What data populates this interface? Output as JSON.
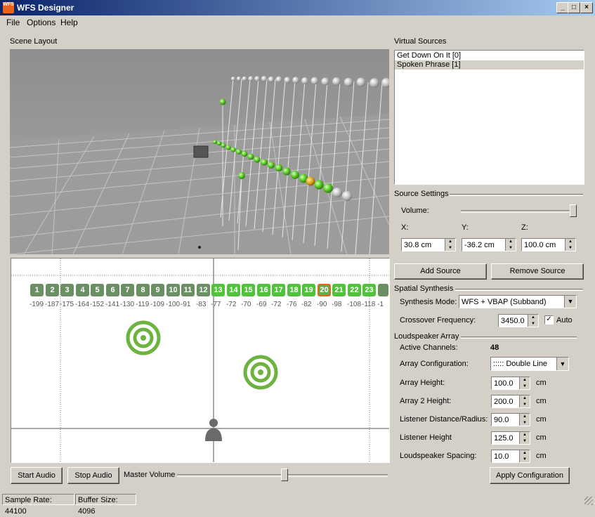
{
  "window": {
    "title": "WFS Designer",
    "icon_text": "WFS",
    "buttons": {
      "minimize": "_",
      "maximize": "□",
      "close": "×"
    }
  },
  "menu": [
    "File",
    "Options",
    "Help"
  ],
  "scene": {
    "label": "Scene Layout"
  },
  "channels": [
    {
      "num": "1",
      "dist": "-199",
      "state": "gray"
    },
    {
      "num": "2",
      "dist": "-187",
      "state": "gray"
    },
    {
      "num": "3",
      "dist": "-175",
      "state": "gray"
    },
    {
      "num": "4",
      "dist": "-164",
      "state": "gray"
    },
    {
      "num": "5",
      "dist": "-152",
      "state": "gray"
    },
    {
      "num": "6",
      "dist": "-141",
      "state": "gray"
    },
    {
      "num": "7",
      "dist": "-130",
      "state": "gray"
    },
    {
      "num": "8",
      "dist": "-119",
      "state": "gray"
    },
    {
      "num": "9",
      "dist": "-109",
      "state": "gray"
    },
    {
      "num": "10",
      "dist": "-100",
      "state": "gray"
    },
    {
      "num": "11",
      "dist": "-91",
      "state": "gray"
    },
    {
      "num": "12",
      "dist": "-83",
      "state": "gray"
    },
    {
      "num": "13",
      "dist": "-77",
      "state": "green"
    },
    {
      "num": "14",
      "dist": "-72",
      "state": "green"
    },
    {
      "num": "15",
      "dist": "-70",
      "state": "green"
    },
    {
      "num": "16",
      "dist": "-69",
      "state": "green"
    },
    {
      "num": "17",
      "dist": "-72",
      "state": "green"
    },
    {
      "num": "18",
      "dist": "-76",
      "state": "green"
    },
    {
      "num": "19",
      "dist": "-82",
      "state": "green"
    },
    {
      "num": "20",
      "dist": "-90",
      "state": "orange"
    },
    {
      "num": "21",
      "dist": "-98",
      "state": "green"
    },
    {
      "num": "22",
      "dist": "-108",
      "state": "green"
    },
    {
      "num": "23",
      "dist": "-118",
      "state": "green"
    },
    {
      "num": "",
      "dist": "-1",
      "state": "gray"
    }
  ],
  "audio": {
    "start_label": "Start Audio",
    "stop_label": "Stop Audio",
    "master_volume_label": "Master Volume",
    "master_volume_level": 0.51
  },
  "virtual_sources": {
    "label": "Virtual Sources",
    "items": [
      {
        "label": "Get Down On It [0]",
        "selected": false
      },
      {
        "label": "Spoken Phrase [1]",
        "selected": true
      }
    ]
  },
  "source_settings": {
    "label": "Source Settings",
    "volume_label": "Volume:",
    "volume_level": 1.0,
    "x_label": "X:",
    "y_label": "Y:",
    "z_label": "Z:",
    "x_value": "30.8 cm",
    "y_value": "-36.2 cm",
    "z_value": "100.0 cm",
    "add_label": "Add Source",
    "remove_label": "Remove Source"
  },
  "spatial": {
    "label": "Spatial Synthesis",
    "mode_label": "Synthesis Mode:",
    "mode_value": "WFS + VBAP (Subband)",
    "crossover_label": "Crossover Frequency:",
    "crossover_value": "3450.0",
    "auto_label": "Auto",
    "auto_checked": "✓"
  },
  "array": {
    "label": "Loudspeaker Array",
    "active_label": "Active Channels:",
    "active_value": "48",
    "config_label": "Array Configuration:",
    "config_value": "::::: Double Line",
    "height_label": "Array Height:",
    "height_value": "100.0",
    "height2_label": "Array 2 Height:",
    "height2_value": "200.0",
    "listener_dist_label": "Listener Distance/Radius:",
    "listener_dist_value": "90.0",
    "listener_height_label": "Listener Height",
    "listener_height_value": "125.0",
    "spacing_label": "Loudspeaker Spacing:",
    "spacing_value": "10.0",
    "unit": "cm",
    "apply_label": "Apply Configuration"
  },
  "status": {
    "sample_rate": "Sample Rate: 44100",
    "buffer_size": "Buffer Size: 4096"
  }
}
